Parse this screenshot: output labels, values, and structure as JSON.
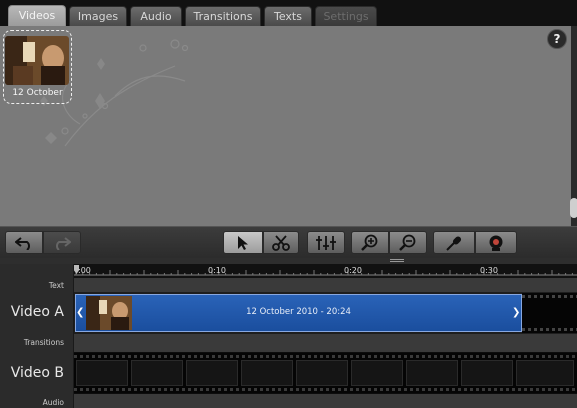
{
  "tabs": [
    {
      "label": "Videos",
      "state": "active"
    },
    {
      "label": "Images",
      "state": "normal"
    },
    {
      "label": "Audio",
      "state": "normal"
    },
    {
      "label": "Transitions",
      "state": "normal"
    },
    {
      "label": "Texts",
      "state": "normal"
    },
    {
      "label": "Settings",
      "state": "disabled"
    }
  ],
  "library": {
    "help_label": "?",
    "clips": [
      {
        "label": "12 October",
        "icon": "video-thumbnail"
      }
    ]
  },
  "toolbar": {
    "buttons": [
      {
        "icon": "undo-icon"
      },
      {
        "icon": "redo-icon",
        "enabled": false
      },
      {
        "icon": "pointer-icon",
        "selected": true
      },
      {
        "icon": "scissors-icon"
      },
      {
        "icon": "mixer-icon"
      },
      {
        "icon": "zoom-in-icon"
      },
      {
        "icon": "zoom-out-icon"
      },
      {
        "icon": "microphone-icon"
      },
      {
        "icon": "webcam-icon"
      }
    ]
  },
  "timeline": {
    "ruler": [
      ":00",
      "0:10",
      "0:20",
      "0:30"
    ],
    "tracks": {
      "text": "Text",
      "video_a": "Video A",
      "transitions": "Transitions",
      "video_b": "Video B",
      "audio": "Audio"
    },
    "clip_title": "12 October 2010 - 20:24"
  },
  "colors": {
    "clip_blue": "#1f56a8",
    "library_bg": "#7a7a7a"
  }
}
